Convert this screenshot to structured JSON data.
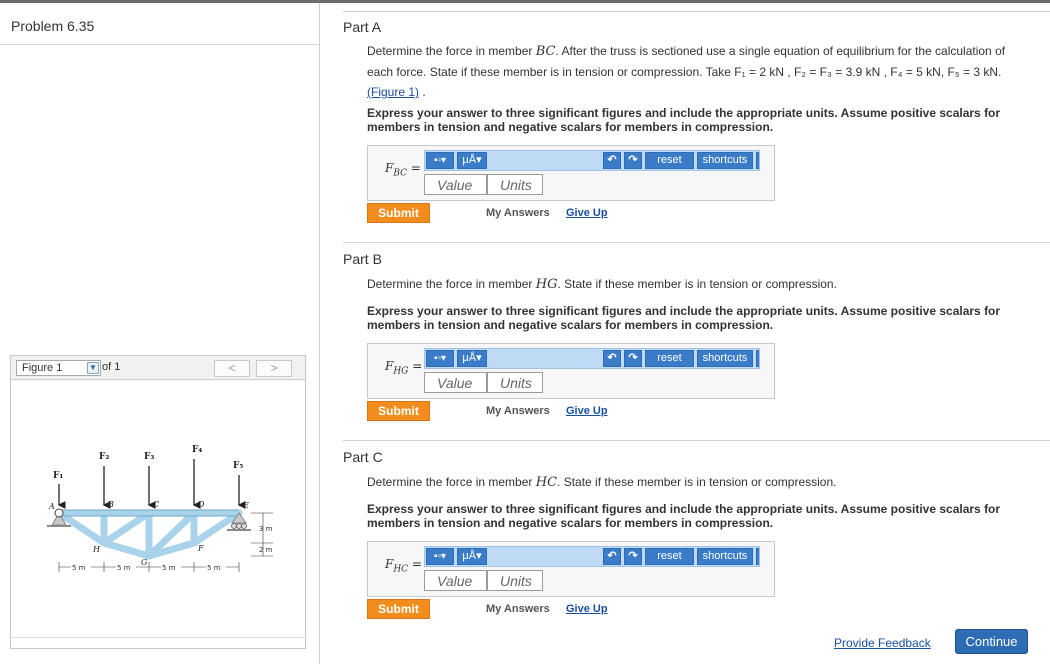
{
  "problem": {
    "title": "Problem 6.35"
  },
  "figure": {
    "select_label": "Figure 1",
    "of_label": "of 1",
    "prev": "<",
    "next": ">",
    "labels": {
      "F1": "F₁",
      "F2": "F₂",
      "F3": "F₃",
      "F4": "F₄",
      "F5": "F₅",
      "A": "A",
      "B": "B",
      "C": "C",
      "D": "D",
      "E": "E",
      "F": "F",
      "G": "G",
      "H": "H",
      "dim_3m": "3 m",
      "dim_2m": "2 m",
      "dim_5m": "5 m"
    }
  },
  "parts": [
    {
      "title": "Part A",
      "prompt_before": "Determine the force in member ",
      "member": "BC",
      "prompt_after": ". After the truss is sectioned use a single equation of equilibrium for the calculation of each force. State if these member is in tension or compression. Take F₁ = 2 kN , F₂ = F₃ = 3.9 kN , F₄ = 5 kN, F₅ = 3 kN.",
      "figure_link": "(Figure 1)",
      "figure_link_tail": " .",
      "instruction": "Express your answer to three significant figures and include the appropriate units. Assume positive scalars for members in tension and negative scalars for members in compression.",
      "label": "F",
      "label_sub": "BC",
      "label_eq": " ="
    },
    {
      "title": "Part B",
      "prompt_before": "Determine the force in member ",
      "member": "HG",
      "prompt_after": ". State if these member is in tension or compression.",
      "instruction": "Express your answer to three significant figures and include the appropriate units. Assume positive scalars for members in tension and negative scalars for members in compression.",
      "label": "F",
      "label_sub": "HG",
      "label_eq": " ="
    },
    {
      "title": "Part C",
      "prompt_before": "Determine the force in member ",
      "member": "HC",
      "prompt_after": ". State if these member is in tension or compression.",
      "instruction": "Express your answer to three significant figures and include the appropriate units. Assume positive scalars for members in tension and negative scalars for members in compression.",
      "label": "F",
      "label_sub": "HC",
      "label_eq": " ="
    }
  ],
  "answer_ui": {
    "templates_glyph": "▪▫▾",
    "units_glyph": "μÅ▾",
    "undo_glyph": "↶",
    "redo_glyph": "↷",
    "reset_label": "reset",
    "shortcuts_label": "shortcuts",
    "value_placeholder": "Value",
    "units_placeholder": "Units",
    "submit_label": "Submit",
    "my_answers_label": "My Answers",
    "give_up_label": "Give Up"
  },
  "footer": {
    "feedback_label": "Provide Feedback",
    "continue_label": "Continue"
  },
  "colors": {
    "submit": "#f28c1c",
    "toolbar": "#bfdaf5",
    "toolbar_button": "#3a7cc8",
    "continue": "#2e6cb5",
    "truss_member": "#a9d3ea",
    "link": "#1a4fa0"
  }
}
